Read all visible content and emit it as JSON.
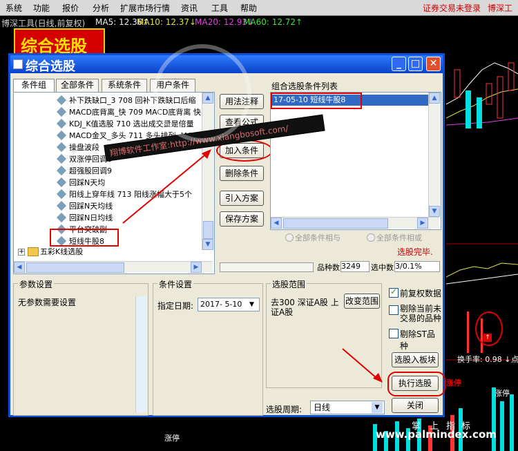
{
  "menu": {
    "items": [
      "系统",
      "功能",
      "报价",
      "分析",
      "扩展市场行情",
      "资讯",
      "工具",
      "帮助"
    ],
    "right_links": [
      "证券交易未登录",
      "博深工具"
    ]
  },
  "statusline": {
    "prefix": "博深工具(日线,前复权)",
    "ma5": "MA5: 12.36↑",
    "ma10": "MA10: 12.37↓",
    "ma20": "MA20: 12.93↓",
    "ma60": "MA60: 12.72↑"
  },
  "banner": {
    "text": "综合选股"
  },
  "dialog": {
    "title": "综合选股",
    "tabs": [
      "条件组",
      "全部条件",
      "系统条件",
      "用户条件"
    ],
    "tree_items": [
      "补下跌缺口_3  708  回补下跌缺口后缩",
      "MACD底背离_快  709 MACD底背离 快",
      "KDJ_K值选股  710 选出成交量是倍量",
      "MACD金叉_多头  711  多头排列, MACD",
      "操盘波段",
      "双涨停回调8",
      "超强股回调9",
      "回踩N天均",
      "阳线上穿年线  713 阳线涨幅大于5个",
      "回踩N天均线",
      "回踩N日均线",
      "平台突破副",
      "短线牛股8"
    ],
    "tree_group": "五彩K线选股",
    "mid_buttons": [
      "用法注释",
      "查看公式",
      "加入条件",
      "删除条件",
      "引入方案",
      "保存方案"
    ],
    "list_title": "组合选股条件列表",
    "list_items": [
      "17-05-10  短线牛股8"
    ],
    "radio_and": "全部条件相与",
    "radio_or": "全部条件相或",
    "status": "选股完毕.",
    "count_label": "品种数",
    "count_value": "3249",
    "selected_label": "选中数",
    "selected_value": "3/0.1%",
    "params_title": "参数设置",
    "params_text": "无参数需要设置",
    "cond_title": "条件设置",
    "date_label": "指定日期:",
    "date_value": "2017- 5-10",
    "range_title": "选股范围",
    "range_text": "去300 深证A股 上证A股",
    "range_button": "改变范围",
    "checks": [
      "前复权数据",
      "剔除当前未交易的品种",
      "剔除ST品种"
    ],
    "period_label": "选股周期:",
    "period_value": "日线",
    "action_buttons": [
      "选股入板块",
      "执行选股",
      "关闭"
    ]
  },
  "overlay_text": "翔博软件工作室:http://www.xiangbosoft.com/",
  "chart_side": {
    "turnover": "换手率: 0.98 ↓",
    "label_right": "点",
    "bottom_labels": [
      "涨停",
      "涨停",
      "涨停",
      "掌",
      "上",
      "指",
      "标"
    ]
  },
  "watermark": "www.palmindex.com",
  "colors": {
    "accent": "#0842c8",
    "red": "#e00000",
    "banner_bg": "#d40000",
    "banner_text": "#ffe000"
  }
}
